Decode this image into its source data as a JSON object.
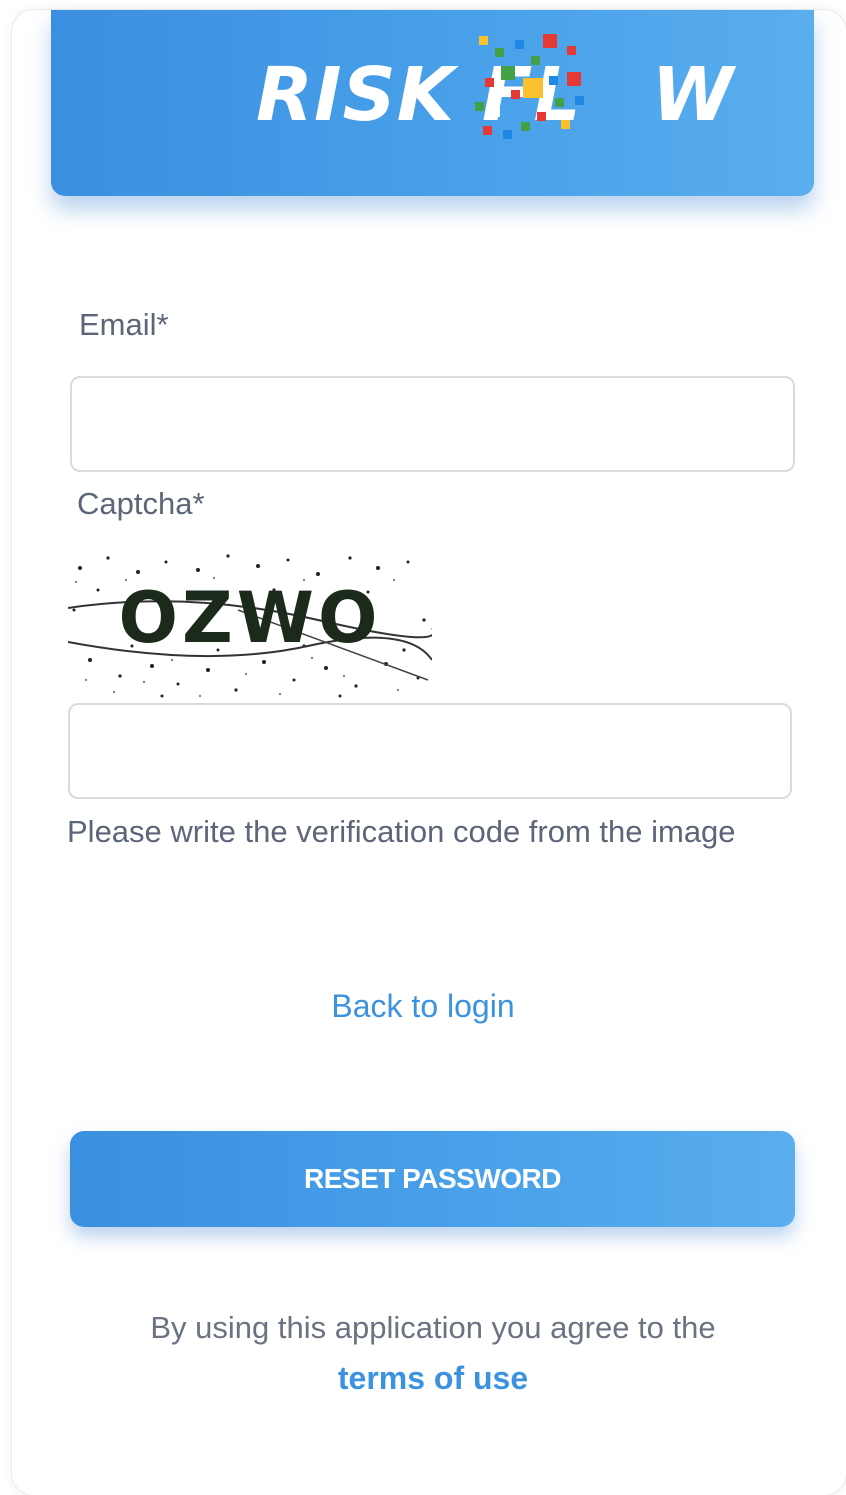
{
  "brand": {
    "logo_text_left": "RISK FL",
    "logo_text_right": "W",
    "accent_color": "#4a9fe8",
    "pixel_colors": [
      "#e53935",
      "#43a047",
      "#fbc02d",
      "#1e88e5",
      "#ffffff"
    ]
  },
  "form": {
    "email_label": "Email*",
    "email_value": "",
    "captcha_label": "Captcha*",
    "captcha_code": "OZWO",
    "captcha_value": "",
    "captcha_hint": "Please write the verification code from the image"
  },
  "links": {
    "back_to_login": "Back to login",
    "terms_prefix": "By using this application you agree to the",
    "terms_of_use": "terms of use"
  },
  "buttons": {
    "reset_password": "RESET PASSWORD"
  }
}
